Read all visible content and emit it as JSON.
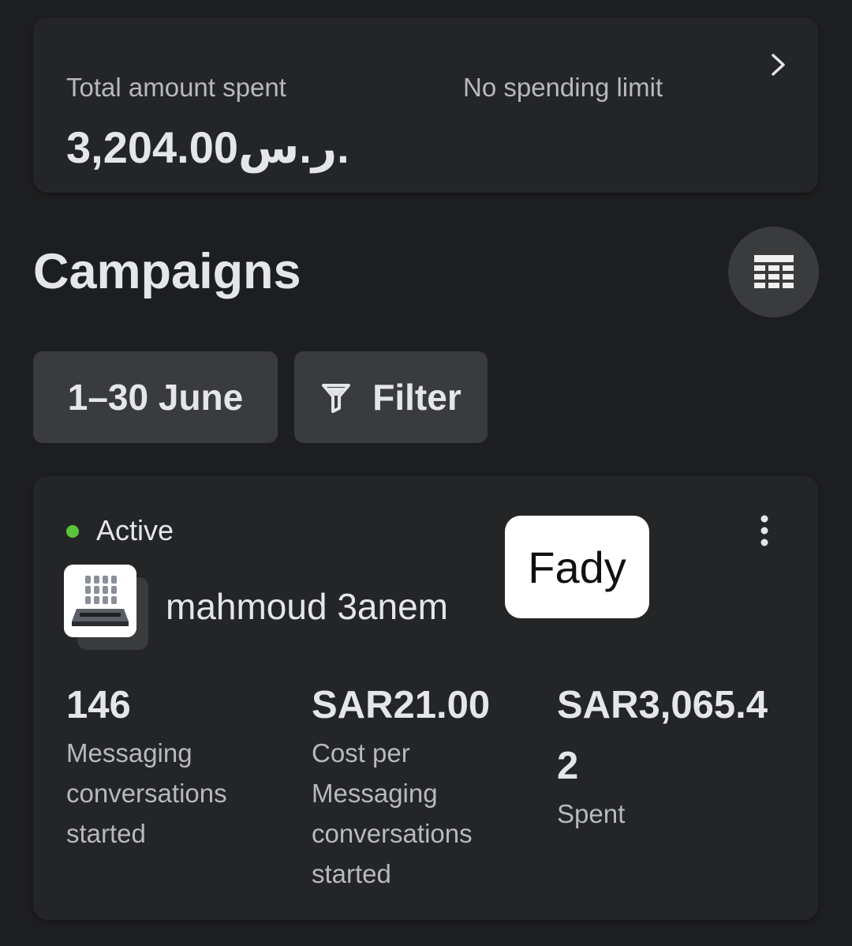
{
  "spend_summary": {
    "label": "Total amount spent",
    "value": "3,204.00ر.س.",
    "limit_label": "No spending limit",
    "chevron_icon": "chevron-right-icon"
  },
  "campaigns": {
    "title": "Campaigns",
    "table_icon": "table-icon",
    "date_range": "1–30 June",
    "filter_label": "Filter",
    "filter_icon": "filter-icon"
  },
  "campaign": {
    "status": "Active",
    "status_color": "#5ac43b",
    "name": "mahmoud 3anem",
    "overlay_text": "Fady",
    "more_icon": "more-vertical-icon",
    "metrics": [
      {
        "value": "146",
        "label": "Messaging conversations started"
      },
      {
        "value": "SAR21.00",
        "label": "Cost per Messaging conversations started"
      },
      {
        "value": "SAR3,065.42",
        "label": "Spent"
      }
    ]
  }
}
